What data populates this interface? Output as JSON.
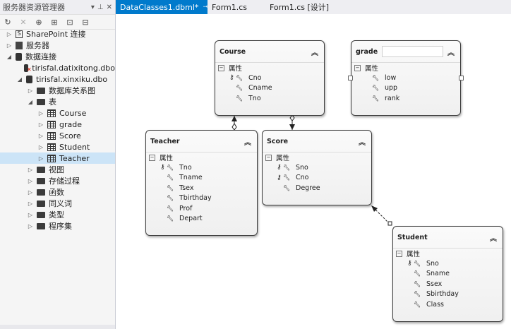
{
  "server_explorer": {
    "title": "服务器资源管理器",
    "tree": [
      {
        "label": "SharePoint 连接",
        "level": 0,
        "expanded": false,
        "icon": "sharepoint-icon"
      },
      {
        "label": "服务器",
        "level": 0,
        "expanded": false,
        "icon": "server-icon"
      },
      {
        "label": "数据连接",
        "level": 0,
        "expanded": true,
        "icon": "data-connection-icon"
      },
      {
        "label": "tirisfal.datixitong.dbo",
        "level": 1,
        "expanded": null,
        "icon": "database-error-icon"
      },
      {
        "label": "tirisfal.xinxiku.dbo",
        "level": 1,
        "expanded": true,
        "icon": "database-icon"
      },
      {
        "label": "数据库关系图",
        "level": 2,
        "expanded": false,
        "icon": "folder-icon"
      },
      {
        "label": "表",
        "level": 2,
        "expanded": true,
        "icon": "folder-icon"
      },
      {
        "label": "Course",
        "level": 3,
        "expanded": false,
        "icon": "table-icon"
      },
      {
        "label": "grade",
        "level": 3,
        "expanded": false,
        "icon": "table-icon"
      },
      {
        "label": "Score",
        "level": 3,
        "expanded": false,
        "icon": "table-icon"
      },
      {
        "label": "Student",
        "level": 3,
        "expanded": false,
        "icon": "table-icon"
      },
      {
        "label": "Teacher",
        "level": 3,
        "expanded": false,
        "icon": "table-icon",
        "selected": true
      },
      {
        "label": "视图",
        "level": 2,
        "expanded": false,
        "icon": "folder-icon"
      },
      {
        "label": "存储过程",
        "level": 2,
        "expanded": false,
        "icon": "folder-icon"
      },
      {
        "label": "函数",
        "level": 2,
        "expanded": false,
        "icon": "folder-icon"
      },
      {
        "label": "同义词",
        "level": 2,
        "expanded": false,
        "icon": "folder-icon"
      },
      {
        "label": "类型",
        "level": 2,
        "expanded": false,
        "icon": "folder-icon"
      },
      {
        "label": "程序集",
        "level": 2,
        "expanded": false,
        "icon": "folder-icon"
      }
    ]
  },
  "tabs": [
    {
      "label": "DataClasses1.dbml*",
      "active": true
    },
    {
      "label": "Form1.cs",
      "active": false
    },
    {
      "label": "Form1.cs [设计]",
      "active": false
    }
  ],
  "section_label": "属性",
  "entities": {
    "course": {
      "name": "Course",
      "props": [
        {
          "name": "Cno",
          "key": true
        },
        {
          "name": "Cname",
          "key": false
        },
        {
          "name": "Tno",
          "key": false
        }
      ]
    },
    "grade": {
      "name": "grade",
      "props": [
        {
          "name": "low",
          "key": false
        },
        {
          "name": "upp",
          "key": false
        },
        {
          "name": "rank",
          "key": false
        }
      ]
    },
    "teacher": {
      "name": "Teacher",
      "props": [
        {
          "name": "Tno",
          "key": true
        },
        {
          "name": "Tname",
          "key": false
        },
        {
          "name": "Tsex",
          "key": false
        },
        {
          "name": "Tbirthday",
          "key": false
        },
        {
          "name": "Prof",
          "key": false
        },
        {
          "name": "Depart",
          "key": false
        }
      ]
    },
    "score": {
      "name": "Score",
      "props": [
        {
          "name": "Sno",
          "key": true
        },
        {
          "name": "Cno",
          "key": true
        },
        {
          "name": "Degree",
          "key": false
        }
      ]
    },
    "student": {
      "name": "Student",
      "props": [
        {
          "name": "Sno",
          "key": true
        },
        {
          "name": "Sname",
          "key": false
        },
        {
          "name": "Ssex",
          "key": false
        },
        {
          "name": "Sbirthday",
          "key": false
        },
        {
          "name": "Class",
          "key": false
        }
      ]
    }
  }
}
